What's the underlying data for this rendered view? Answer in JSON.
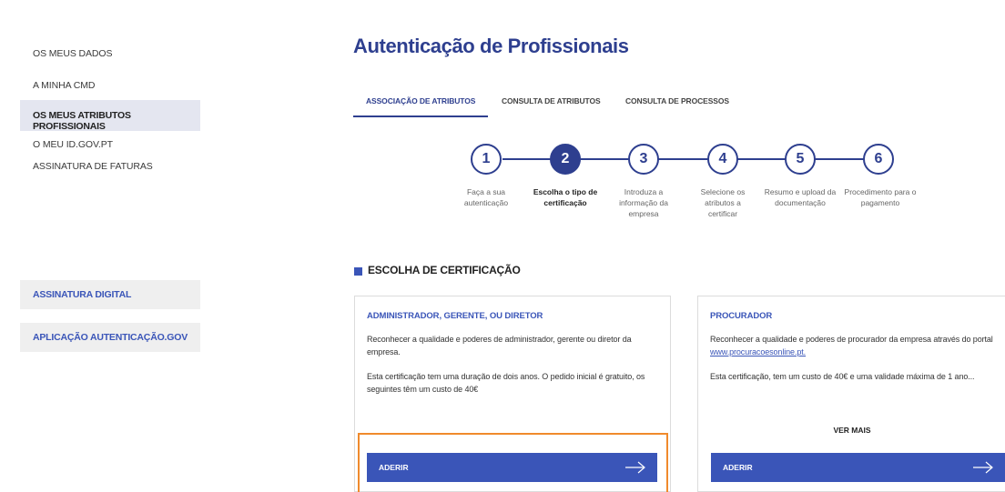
{
  "sidebar": {
    "items": [
      {
        "label": "OS MEUS DADOS"
      },
      {
        "label": "A MINHA CMD"
      },
      {
        "label": "OS MEUS ATRIBUTOS PROFISSIONAIS",
        "active": true
      },
      {
        "label": "O MEU ID.GOV.PT"
      },
      {
        "label": "ASSINATURA DE FATURAS"
      }
    ],
    "boxes": [
      {
        "label": "ASSINATURA DIGITAL"
      },
      {
        "label": "APLICAÇÃO AUTENTICAÇÃO.GOV"
      }
    ]
  },
  "main": {
    "title": "Autenticação de Profissionais",
    "tabs": [
      {
        "label": "ASSOCIAÇÃO DE ATRIBUTOS",
        "active": true
      },
      {
        "label": "CONSULTA DE ATRIBUTOS"
      },
      {
        "label": "CONSULTA DE PROCESSOS"
      }
    ],
    "steps": [
      {
        "number": "1",
        "label": "Faça a sua autenticação"
      },
      {
        "number": "2",
        "label": "Escolha o tipo de certificação",
        "current": true
      },
      {
        "number": "3",
        "label": "Introduza a informação da empresa"
      },
      {
        "number": "4",
        "label": "Selecione os atributos a certificar"
      },
      {
        "number": "5",
        "label": "Resumo e upload da documentação"
      },
      {
        "number": "6",
        "label": "Procedimento para o pagamento"
      }
    ],
    "section_title": "ESCOLHA DE CERTIFICAÇÃO",
    "cards": [
      {
        "title": "ADMINISTRADOR, GERENTE, OU DIRETOR",
        "paragraph1": "Reconhecer a qualidade e poderes de administrador, gerente ou diretor da empresa.",
        "paragraph2": "Esta certificação tem uma duração de dois anos. O pedido inicial é gratuito, os seguintes têm um custo de 40€",
        "button_label": "ADERIR"
      },
      {
        "title": "PROCURADOR",
        "paragraph1_prefix": "Reconhecer a qualidade e poderes de procurador da empresa através do portal ",
        "paragraph1_link": "www.procuracoesonline.pt.",
        "paragraph2": "Esta certificação, tem um custo de 40€ e uma validade máxima de 1 ano...",
        "ver_mais": "VER MAIS",
        "button_label": "ADERIR"
      }
    ]
  },
  "colors": {
    "primary": "#2e3f8f",
    "button": "#3a55b8",
    "highlight": "#f08a2c",
    "active_nav_bg": "#e4e6f0"
  },
  "icons": {
    "cta_arrow": "arrow-right-icon"
  }
}
